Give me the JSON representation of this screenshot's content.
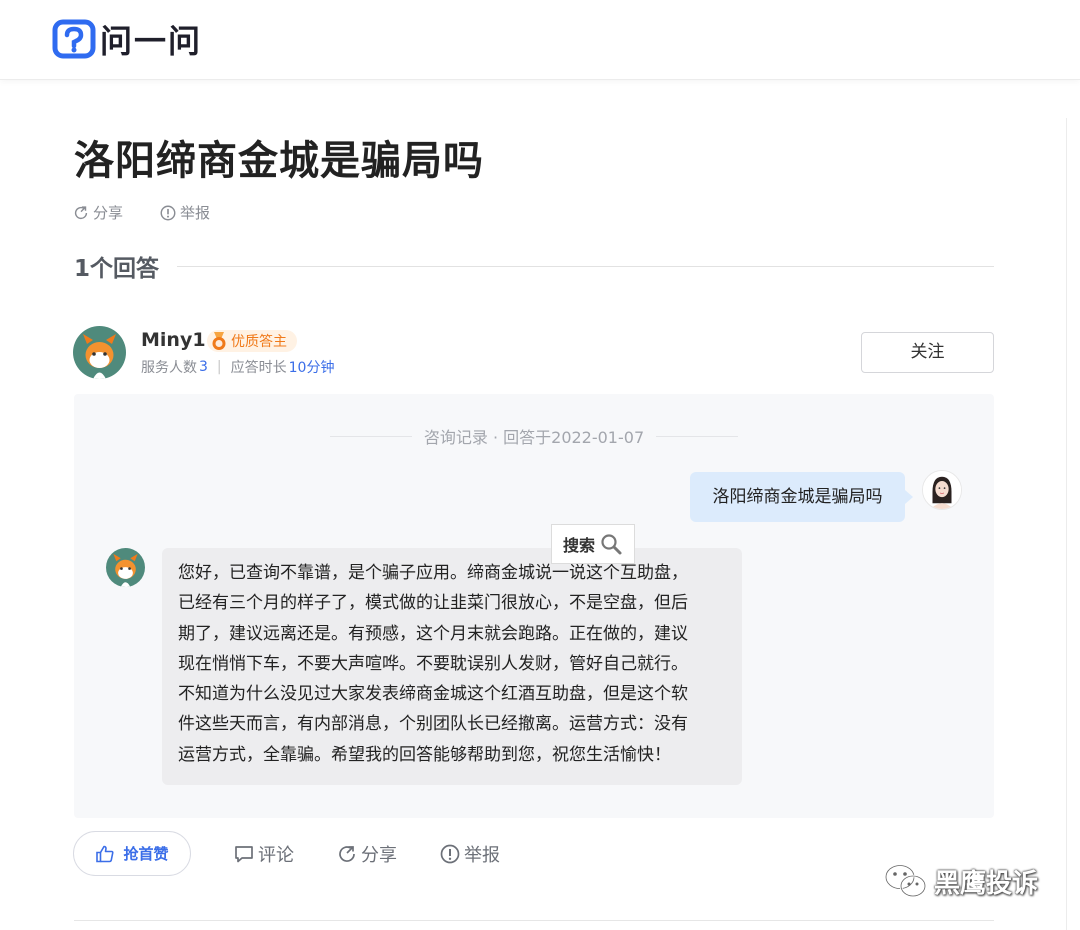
{
  "brand": {
    "name": "问一问",
    "color": "#2f6bf0"
  },
  "question": {
    "title": "洛阳缔商金城是骗局吗"
  },
  "question_actions": {
    "share": "分享",
    "report": "举报"
  },
  "answers_header": {
    "count_label": "1个回答"
  },
  "answerer": {
    "name": "Miny1",
    "badge": "优质答主",
    "served_label": "服务人数",
    "served_count": "3",
    "response_label": "应答时长",
    "response_time": "10分钟",
    "follow_label": "关注"
  },
  "chat": {
    "header": "咨询记录 · 回答于2022-01-07",
    "user_message": "洛阳缔商金城是骗局吗",
    "answer_lines": [
      "您好，已查询不靠谱，是个骗子应用。缔商金城说一说这个互助盘，",
      "已经有三个月的样子了，模式做的让韭菜门很放心，不是空盘，但后",
      "期了，建议远离还是。有预感，这个月末就会跑路。正在做的，建议",
      "现在悄悄下车，不要大声喧哗。不要耽误别人发财，管好自己就行。",
      "不知道为什么没见过大家发表缔商金城这个红酒互助盘，但是这个软",
      "件这些天而言，有内部消息，个别团队长已经撤离。运营方式：没有",
      "运营方式，全靠骗。希望我的回答能够帮助到您，祝您生活愉快！"
    ]
  },
  "search_popup": {
    "label": "搜索"
  },
  "answer_actions": {
    "like": "抢首赞",
    "comment": "评论",
    "share": "分享",
    "report": "举报"
  },
  "watermark": {
    "text": "黑鹰投诉"
  },
  "colors": {
    "accent": "#3b6ee8",
    "badge": "#f07a1a",
    "bubble_user": "#dcebfc",
    "bubble_answer": "#ededef"
  }
}
